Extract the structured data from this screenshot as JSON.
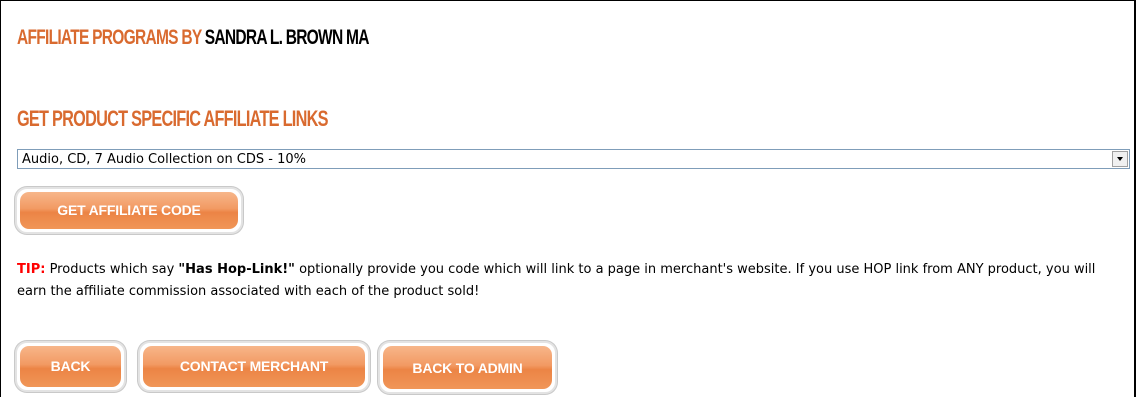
{
  "header": {
    "title_prefix": "AFFILIATE PROGRAMS BY",
    "title_name": "SANDRA L. BROWN MA"
  },
  "links_section": {
    "heading": "GET PRODUCT SPECIFIC AFFILIATE LINKS",
    "product_select": {
      "selected_value": "Audio, CD, 7 Audio Collection on CDS - 10%"
    },
    "get_code_label": "GET AFFILIATE CODE"
  },
  "tip": {
    "label": "TIP:",
    "text_part1": " Products which say ",
    "highlight": "\"Has Hop-Link!\"",
    "text_part2": " optionally provide you code which will link to a page in merchant's website. If you use HOP link from ANY product, you will earn the affiliate commission associated with each of the product sold!"
  },
  "footer_buttons": {
    "back_label": "BACK",
    "contact_label": "CONTACT MERCHANT",
    "admin_label": "BACK TO ADMIN"
  },
  "colors": {
    "accent": "#d96a2f",
    "button_orange": "#f29a63",
    "tip_red": "#ff0000"
  }
}
